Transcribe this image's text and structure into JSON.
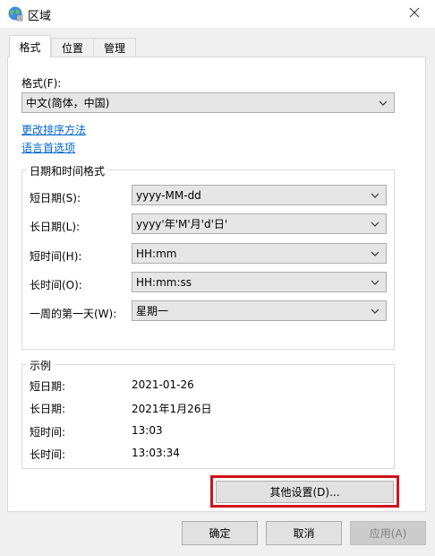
{
  "window": {
    "title": "区域",
    "close_icon": "close-icon",
    "app_icon": "globe-icon"
  },
  "tabs": [
    {
      "label": "格式",
      "active": true
    },
    {
      "label": "位置",
      "active": false
    },
    {
      "label": "管理",
      "active": false
    }
  ],
  "format": {
    "label": "格式(F):",
    "value": "中文(简体，中国)"
  },
  "links": {
    "sort": "更改排序方法",
    "language": "语言首选项"
  },
  "datetime": {
    "group_title": "日期和时间格式",
    "rows": [
      {
        "label": "短日期(S):",
        "value": "yyyy-MM-dd"
      },
      {
        "label": "长日期(L):",
        "value": "yyyy'年'M'月'd'日'"
      },
      {
        "label": "短时间(H):",
        "value": "HH:mm"
      },
      {
        "label": "长时间(O):",
        "value": "HH:mm:ss"
      },
      {
        "label": "一周的第一天(W):",
        "value": "星期一"
      }
    ]
  },
  "examples": {
    "group_title": "示例",
    "rows": [
      {
        "label": "短日期:",
        "value": "2021-01-26"
      },
      {
        "label": "长日期:",
        "value": "2021年1月26日"
      },
      {
        "label": "短时间:",
        "value": "13:03"
      },
      {
        "label": "长时间:",
        "value": "13:03:34"
      }
    ]
  },
  "buttons": {
    "other_settings": "其他设置(D)...",
    "ok": "确定",
    "cancel": "取消",
    "apply": "应用(A)"
  },
  "colors": {
    "highlight": "#d0121b",
    "link": "#0066cc"
  }
}
